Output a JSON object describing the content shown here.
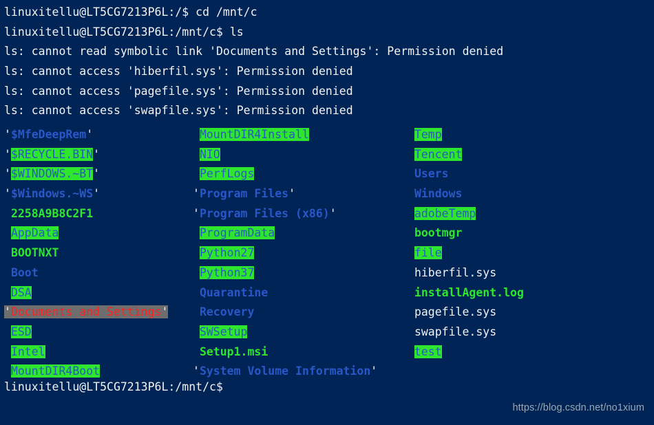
{
  "terminal": {
    "background_color": "#012456",
    "foreground_color": "#f2f2f2",
    "colors": {
      "directory_blue": "#2a57c8",
      "other_writable_bg": "#2ee62e",
      "executable_green": "#2ee62e",
      "broken_link_bg": "#6e6e6e",
      "broken_link_fg": "#ff2020"
    },
    "header_lines": [
      "linuxitellu@LT5CG7213P6L:/$ cd /mnt/c",
      "linuxitellu@LT5CG7213P6L:/mnt/c$ ls",
      "ls: cannot read symbolic link 'Documents and Settings': Permission denied",
      "ls: cannot access 'hiberfil.sys': Permission denied",
      "ls: cannot access 'pagefile.sys': Permission denied",
      "ls: cannot access 'swapfile.sys': Permission denied"
    ],
    "prompt": "linuxitellu@LT5CG7213P6L:/mnt/c$",
    "watermark": "https://blog.csdn.net/no1xium",
    "command": "ls",
    "working_directory": "/mnt/c",
    "user": "linuxitellu",
    "host": "LT5CG7213P6L"
  },
  "listing": {
    "columns": [
      {
        "name": "column-1",
        "entries": [
          {
            "name": "$MfeDeepRem",
            "quoted": true,
            "style": "dir"
          },
          {
            "name": "$RECYCLE.BIN",
            "quoted": true,
            "style": "dir-ow"
          },
          {
            "name": "$WINDOWS.~BT",
            "quoted": true,
            "style": "dir-ow"
          },
          {
            "name": "$Windows.~WS",
            "quoted": true,
            "style": "dir"
          },
          {
            "name": "2258A9B8C2F1",
            "quoted": false,
            "style": "exec"
          },
          {
            "name": "AppData",
            "quoted": false,
            "style": "dir-ow"
          },
          {
            "name": "BOOTNXT",
            "quoted": false,
            "style": "exec"
          },
          {
            "name": "Boot",
            "quoted": false,
            "style": "dir"
          },
          {
            "name": "DSA",
            "quoted": false,
            "style": "dir-ow"
          },
          {
            "name": "Documents and Settings",
            "quoted": true,
            "style": "broken"
          },
          {
            "name": "ESD",
            "quoted": false,
            "style": "dir-ow"
          },
          {
            "name": "Intel",
            "quoted": false,
            "style": "dir-ow"
          },
          {
            "name": "MountDIR4Boot",
            "quoted": false,
            "style": "dir-ow"
          }
        ]
      },
      {
        "name": "column-2",
        "entries": [
          {
            "name": "MountDIR4Install",
            "quoted": false,
            "style": "dir-ow"
          },
          {
            "name": "NIO",
            "quoted": false,
            "style": "dir-ow"
          },
          {
            "name": "PerfLogs",
            "quoted": false,
            "style": "dir-ow"
          },
          {
            "name": "Program Files",
            "quoted": true,
            "style": "dir"
          },
          {
            "name": "Program Files (x86)",
            "quoted": true,
            "style": "dir"
          },
          {
            "name": "ProgramData",
            "quoted": false,
            "style": "dir-ow"
          },
          {
            "name": "Python27",
            "quoted": false,
            "style": "dir-ow"
          },
          {
            "name": "Python37",
            "quoted": false,
            "style": "dir-ow"
          },
          {
            "name": "Quarantine",
            "quoted": false,
            "style": "dir"
          },
          {
            "name": "Recovery",
            "quoted": false,
            "style": "dir"
          },
          {
            "name": "SWSetup",
            "quoted": false,
            "style": "dir-ow"
          },
          {
            "name": "Setup1.msi",
            "quoted": false,
            "style": "exec"
          },
          {
            "name": "System Volume Information",
            "quoted": true,
            "style": "dir"
          }
        ]
      },
      {
        "name": "column-3",
        "entries": [
          {
            "name": "Temp",
            "quoted": false,
            "style": "dir-ow"
          },
          {
            "name": "Tencent",
            "quoted": false,
            "style": "dir-ow"
          },
          {
            "name": "Users",
            "quoted": false,
            "style": "dir"
          },
          {
            "name": "Windows",
            "quoted": false,
            "style": "dir"
          },
          {
            "name": "adobeTemp",
            "quoted": false,
            "style": "dir-ow"
          },
          {
            "name": "bootmgr",
            "quoted": false,
            "style": "exec"
          },
          {
            "name": "file",
            "quoted": false,
            "style": "dir-ow"
          },
          {
            "name": "hiberfil.sys",
            "quoted": false,
            "style": "file"
          },
          {
            "name": "installAgent.log",
            "quoted": false,
            "style": "exec"
          },
          {
            "name": "pagefile.sys",
            "quoted": false,
            "style": "file"
          },
          {
            "name": "swapfile.sys",
            "quoted": false,
            "style": "file"
          },
          {
            "name": "test",
            "quoted": false,
            "style": "dir-ow"
          }
        ]
      }
    ]
  }
}
